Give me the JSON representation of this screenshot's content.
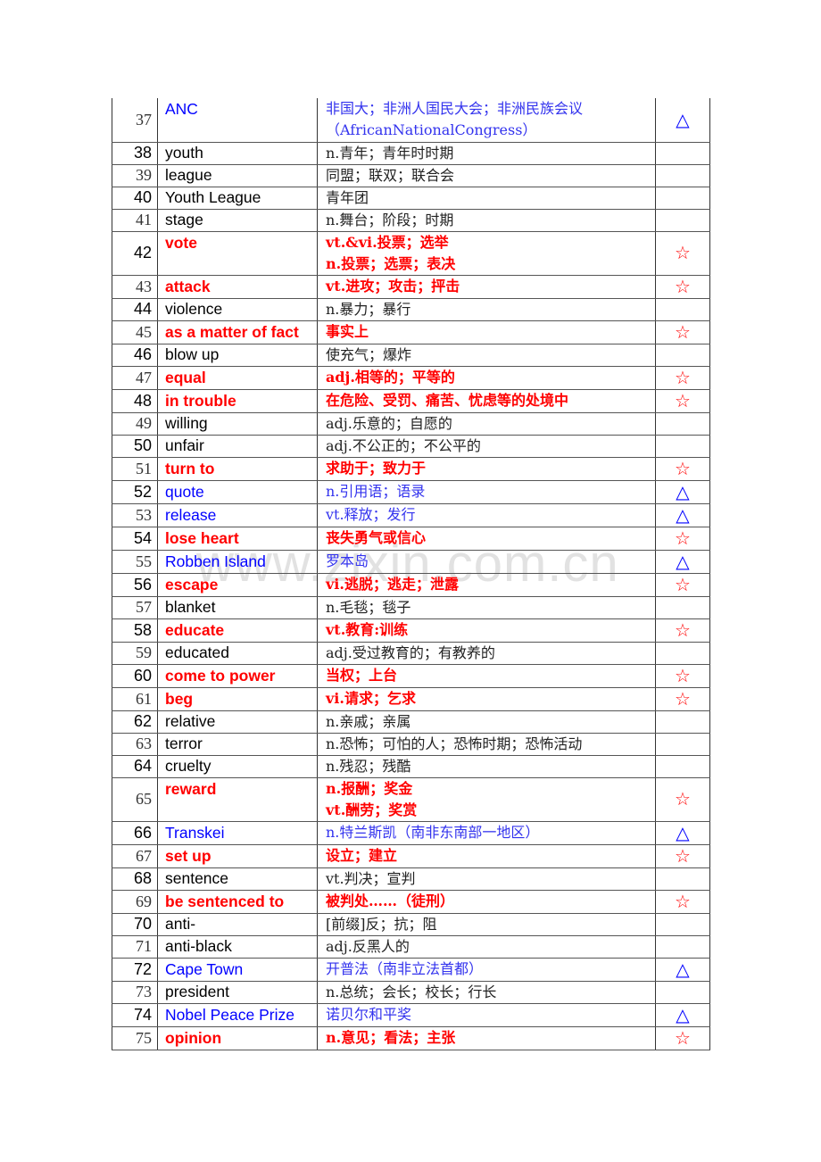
{
  "watermark": "www.zixin.com.cn",
  "colors": {
    "important": "#ff0000",
    "proper_noun": "#0000ff",
    "normal": "#000000"
  },
  "marks": {
    "star": "☆",
    "triangle": "△"
  },
  "rows": [
    {
      "num": "37",
      "word": "ANC",
      "meaning": [
        "非国大；非洲人国民大会；非洲民族会议",
        "（AfricanNationalCongress）"
      ],
      "style": "blue",
      "mark": "△"
    },
    {
      "num": "38",
      "word": "youth",
      "meaning": [
        "n.青年；青年时时期"
      ],
      "style": "normal",
      "mark": ""
    },
    {
      "num": "39",
      "word": "league",
      "meaning": [
        "同盟；联双；联合会"
      ],
      "style": "normal",
      "mark": ""
    },
    {
      "num": "40",
      "word": "Youth League",
      "meaning": [
        "青年团"
      ],
      "style": "normal",
      "mark": ""
    },
    {
      "num": "41",
      "word": "stage",
      "meaning": [
        "n.舞台；阶段；时期"
      ],
      "style": "normal",
      "mark": ""
    },
    {
      "num": "42",
      "word": "vote",
      "meaning": [
        "vt.&vi.投票；选举",
        "n.投票；选票；表决"
      ],
      "style": "red",
      "mark": "☆"
    },
    {
      "num": "43",
      "word": "attack",
      "meaning": [
        "vt.进攻；攻击；抨击"
      ],
      "style": "red",
      "mark": "☆"
    },
    {
      "num": "44",
      "word": "violence",
      "meaning": [
        "n.暴力；暴行"
      ],
      "style": "normal",
      "mark": ""
    },
    {
      "num": "45",
      "word": "as a matter of fact",
      "meaning": [
        "事实上"
      ],
      "style": "red",
      "mark": "☆"
    },
    {
      "num": "46",
      "word": "blow up",
      "meaning": [
        "使充气；爆炸"
      ],
      "style": "normal",
      "mark": ""
    },
    {
      "num": "47",
      "word": "equal",
      "meaning": [
        "adj.相等的；平等的"
      ],
      "style": "red",
      "mark": "☆"
    },
    {
      "num": "48",
      "word": "in trouble",
      "meaning": [
        "在危险、受罚、痛苦、忧虑等的处境中"
      ],
      "style": "red",
      "mark": "☆"
    },
    {
      "num": "49",
      "word": "willing",
      "meaning": [
        "adj.乐意的；自愿的"
      ],
      "style": "normal",
      "mark": ""
    },
    {
      "num": "50",
      "word": "unfair",
      "meaning": [
        "adj.不公正的；不公平的"
      ],
      "style": "normal",
      "mark": ""
    },
    {
      "num": "51",
      "word": "turn to",
      "meaning": [
        "求助于；致力于"
      ],
      "style": "red",
      "mark": "☆"
    },
    {
      "num": "52",
      "word": "quote",
      "meaning": [
        "n.引用语；语录"
      ],
      "style": "blue",
      "mark": "△"
    },
    {
      "num": "53",
      "word": "release",
      "meaning": [
        "vt.释放；发行"
      ],
      "style": "blue",
      "mark": "△"
    },
    {
      "num": "54",
      "word": "lose heart",
      "meaning": [
        "丧失勇气或信心"
      ],
      "style": "red",
      "mark": "☆"
    },
    {
      "num": "55",
      "word": "Robben Island",
      "meaning": [
        "罗本岛"
      ],
      "style": "blue",
      "mark": "△"
    },
    {
      "num": "56",
      "word": "escape",
      "meaning": [
        "vi.逃脱；逃走；泄露"
      ],
      "style": "red",
      "mark": "☆"
    },
    {
      "num": "57",
      "word": "blanket",
      "meaning": [
        "n.毛毯；毯子"
      ],
      "style": "normal",
      "mark": ""
    },
    {
      "num": "58",
      "word": "educate",
      "meaning": [
        "vt.教育:训练"
      ],
      "style": "red",
      "mark": "☆"
    },
    {
      "num": "59",
      "word": "educated",
      "meaning": [
        "adj.受过教育的；有教养的"
      ],
      "style": "normal",
      "mark": ""
    },
    {
      "num": "60",
      "word": "come to power",
      "meaning": [
        "当权；上台"
      ],
      "style": "red",
      "mark": "☆"
    },
    {
      "num": "61",
      "word": "beg",
      "meaning": [
        "vi.请求；乞求"
      ],
      "style": "red",
      "mark": "☆"
    },
    {
      "num": "62",
      "word": "relative",
      "meaning": [
        "n.亲戚；亲属"
      ],
      "style": "normal",
      "mark": ""
    },
    {
      "num": "63",
      "word": "terror",
      "meaning": [
        "n.恐怖；可怕的人；恐怖时期；恐怖活动"
      ],
      "style": "normal",
      "mark": ""
    },
    {
      "num": "64",
      "word": "cruelty",
      "meaning": [
        "n.残忍；残酷"
      ],
      "style": "normal",
      "mark": ""
    },
    {
      "num": "65",
      "word": "reward",
      "meaning": [
        "n.报酬；奖金",
        "vt.酬劳；奖赏"
      ],
      "style": "red",
      "mark": "☆"
    },
    {
      "num": "66",
      "word": "Transkei",
      "meaning": [
        "n.特兰斯凯（南非东南部一地区）"
      ],
      "style": "blue",
      "mark": "△"
    },
    {
      "num": "67",
      "word": "set up",
      "meaning": [
        "设立；建立"
      ],
      "style": "red",
      "mark": "☆"
    },
    {
      "num": "68",
      "word": "sentence",
      "meaning": [
        "vt.判决；宣判"
      ],
      "style": "normal",
      "mark": ""
    },
    {
      "num": "69",
      "word": "be sentenced to",
      "meaning": [
        "被判处……（徒刑）"
      ],
      "style": "red",
      "mark": "☆"
    },
    {
      "num": "70",
      "word": "anti-",
      "meaning": [
        "[前缀]反；抗；阻"
      ],
      "style": "normal",
      "mark": ""
    },
    {
      "num": "71",
      "word": "anti-black",
      "meaning": [
        "adj.反黑人的"
      ],
      "style": "normal",
      "mark": ""
    },
    {
      "num": "72",
      "word": "Cape Town",
      "meaning": [
        "开普法（南非立法首都）"
      ],
      "style": "blue",
      "mark": "△"
    },
    {
      "num": "73",
      "word": "president",
      "meaning": [
        "n.总统；会长；校长；行长"
      ],
      "style": "normal",
      "mark": ""
    },
    {
      "num": "74",
      "word": "Nobel Peace Prize",
      "meaning": [
        "诺贝尔和平奖"
      ],
      "style": "blue",
      "mark": "△"
    },
    {
      "num": "75",
      "word": "opinion",
      "meaning": [
        "n.意见；看法；主张"
      ],
      "style": "red",
      "mark": "☆"
    }
  ]
}
